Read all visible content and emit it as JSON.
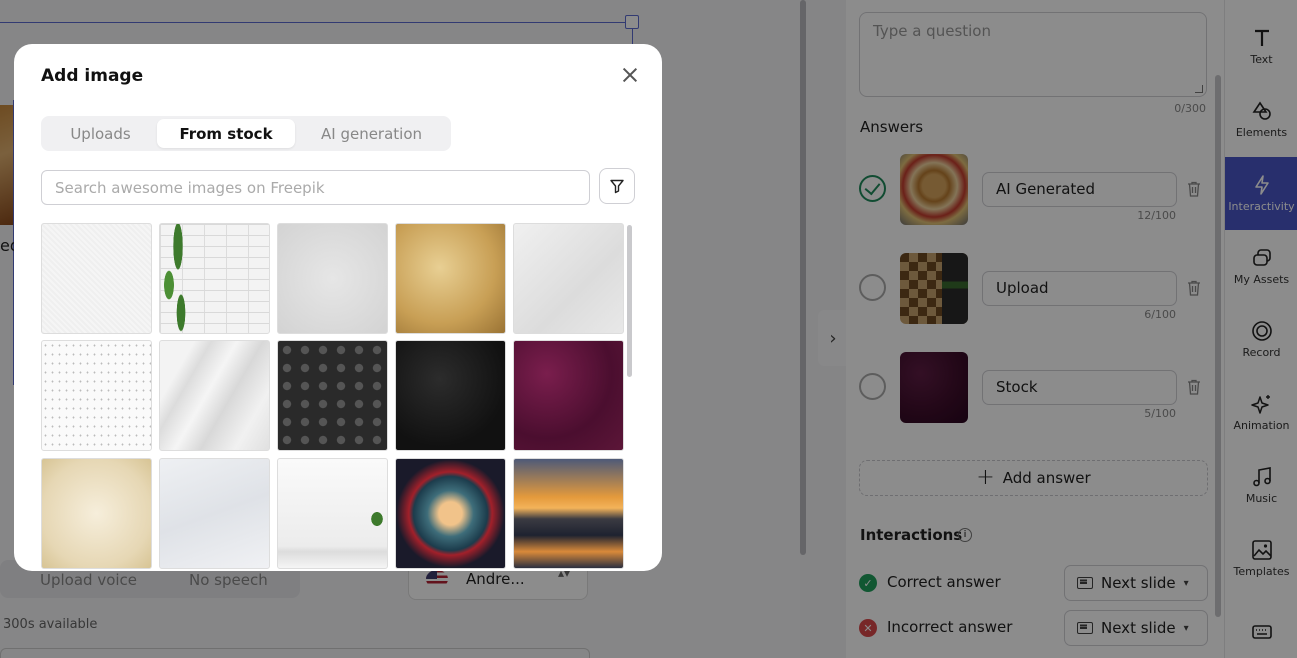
{
  "background": {
    "canvas_peek_text": "ed",
    "upload_voice_label": "Upload voice",
    "no_speech_label": "No speech",
    "voice_name": "Andre...",
    "voice_caret": "▴▾",
    "available_text": "300s available"
  },
  "panel": {
    "question_placeholder": "Type a question",
    "question_count": "0/300",
    "answers_title": "Answers",
    "answers": [
      {
        "label": "AI Generated",
        "count": "12/100",
        "correct": true
      },
      {
        "label": "Upload",
        "count": "6/100",
        "correct": false
      },
      {
        "label": "Stock",
        "count": "5/100",
        "correct": false
      }
    ],
    "add_answer_label": "Add answer",
    "interactions_title": "Interactions",
    "interactions": [
      {
        "label": "Correct answer",
        "action": "Next slide",
        "status": "correct"
      },
      {
        "label": "Incorrect answer",
        "action": "Next slide",
        "status": "incorrect"
      }
    ]
  },
  "rail": {
    "items": [
      {
        "label": "Text",
        "icon": "text-icon"
      },
      {
        "label": "Elements",
        "icon": "shapes-icon"
      },
      {
        "label": "Interactivity",
        "icon": "lightning-icon",
        "active": true
      },
      {
        "label": "My Assets",
        "icon": "assets-icon"
      },
      {
        "label": "Record",
        "icon": "record-icon"
      },
      {
        "label": "Animation",
        "icon": "sparkle-icon"
      },
      {
        "label": "Music",
        "icon": "music-icon"
      },
      {
        "label": "Templates",
        "icon": "image-icon"
      }
    ]
  },
  "modal": {
    "title": "Add image",
    "tabs": [
      {
        "label": "Uploads",
        "active": false
      },
      {
        "label": "From stock",
        "active": true
      },
      {
        "label": "AI generation",
        "active": false
      }
    ],
    "search_placeholder": "Search awesome images on Freepik",
    "images": [
      "white-paper-texture",
      "white-brick-wall-with-plant",
      "gray-paper-texture",
      "old-parchment-texture",
      "light-gray-paper-texture",
      "speckled-white-texture",
      "crumpled-white-paper",
      "black-hexagon-pattern",
      "black-textured-background",
      "burgundy-grunge-texture",
      "cream-paper-texture",
      "white-wrinkled-paper",
      "white-room-with-plant",
      "mountain-lake-circle-art",
      "mountain-lake-sunset"
    ]
  },
  "colors": {
    "accent": "#4a57c6",
    "correct": "#1f9e5c",
    "incorrect": "#d9474a",
    "overlay": "rgba(0,0,0,0.45)"
  }
}
